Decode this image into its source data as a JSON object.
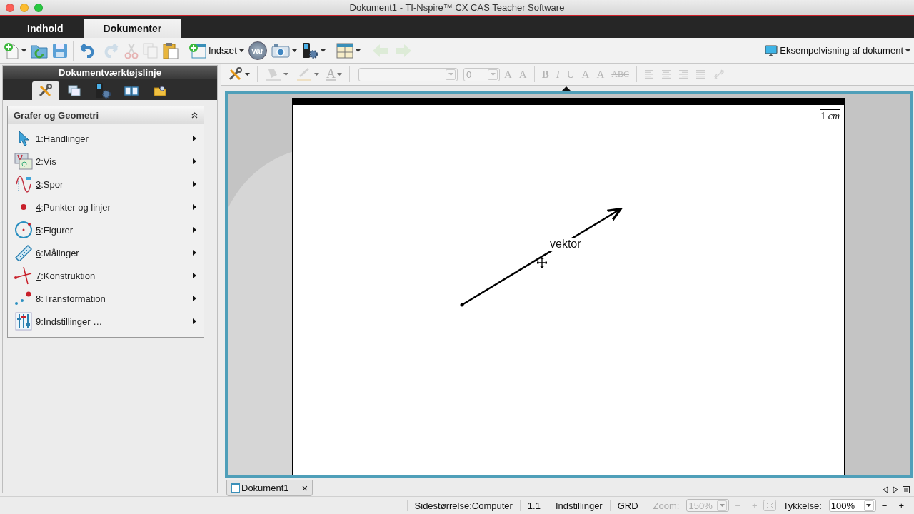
{
  "window": {
    "title": "Dokument1 - TI-Nspire™ CX CAS Teacher Software"
  },
  "tabs": [
    {
      "label": "Indhold",
      "selected": false
    },
    {
      "label": "Dokumenter",
      "selected": true
    }
  ],
  "toolbar": {
    "items": [
      {
        "kind": "new",
        "disabled": false,
        "dropdown": true
      },
      {
        "kind": "open",
        "disabled": false,
        "dropdown": false
      },
      {
        "kind": "save",
        "disabled": false,
        "dropdown": false
      },
      {
        "kind": "sep"
      },
      {
        "kind": "undo",
        "disabled": false,
        "dropdown": false
      },
      {
        "kind": "redo",
        "disabled": true,
        "dropdown": false
      },
      {
        "kind": "cut",
        "disabled": true,
        "dropdown": false
      },
      {
        "kind": "copy",
        "disabled": true,
        "dropdown": false
      },
      {
        "kind": "paste",
        "disabled": false,
        "dropdown": false
      },
      {
        "kind": "sep"
      },
      {
        "kind": "insert",
        "label": "Indsæt",
        "disabled": false,
        "dropdown": true
      },
      {
        "kind": "var",
        "label": "var",
        "disabled": false,
        "dropdown": false
      },
      {
        "kind": "camera",
        "disabled": false,
        "dropdown": true
      },
      {
        "kind": "handheld",
        "disabled": false,
        "dropdown": true
      },
      {
        "kind": "sep"
      },
      {
        "kind": "layout",
        "disabled": false,
        "dropdown": true
      },
      {
        "kind": "sep"
      },
      {
        "kind": "back",
        "disabled": true,
        "dropdown": false
      },
      {
        "kind": "forward",
        "disabled": true,
        "dropdown": false
      }
    ],
    "preview": {
      "label": "Eksempelvisning af dokument",
      "dropdown": true
    }
  },
  "sidebar": {
    "title": "Dokumentværktøjslinje",
    "tool_tabs": [
      {
        "kind": "tools",
        "selected": true
      },
      {
        "kind": "pages",
        "selected": false
      },
      {
        "kind": "handheld",
        "selected": false
      },
      {
        "kind": "book",
        "selected": false
      },
      {
        "kind": "folder",
        "selected": false
      }
    ],
    "menu": {
      "title": "Grafer og Geometri",
      "expanded": true,
      "items": [
        {
          "kind": "pointer",
          "shortcut": "1",
          "label": ":Handlinger"
        },
        {
          "kind": "view",
          "shortcut": "2",
          "label": ":Vis"
        },
        {
          "kind": "trace",
          "shortcut": "3",
          "label": ":Spor"
        },
        {
          "kind": "point",
          "shortcut": "4",
          "label": ":Punkter og linjer"
        },
        {
          "kind": "circle",
          "shortcut": "5",
          "label": ":Figurer"
        },
        {
          "kind": "ruler",
          "shortcut": "6",
          "label": ":Målinger"
        },
        {
          "kind": "construct",
          "shortcut": "7",
          "label": ":Konstruktion"
        },
        {
          "kind": "transform",
          "shortcut": "8",
          "label": ":Transformation"
        },
        {
          "kind": "settings",
          "shortcut": "9",
          "label": ":Indstillinger …"
        }
      ]
    }
  },
  "format_toolbar": {
    "items": [
      {
        "kind": "tools",
        "disabled": false,
        "dropdown": true
      },
      {
        "kind": "sep"
      },
      {
        "kind": "fill",
        "disabled": true,
        "dropdown": true
      },
      {
        "kind": "linecolor",
        "disabled": true,
        "dropdown": true
      },
      {
        "kind": "textcolor",
        "label": "A",
        "disabled": true,
        "dropdown": true
      },
      {
        "kind": "sep"
      },
      {
        "kind": "fontfield",
        "disabled": true
      },
      {
        "kind": "sizefield",
        "value": "0",
        "disabled": true
      },
      {
        "kind": "grow",
        "label": "A",
        "disabled": true
      },
      {
        "kind": "shrink",
        "label": "A",
        "disabled": true
      },
      {
        "kind": "sep"
      },
      {
        "kind": "bold",
        "label": "B",
        "disabled": true
      },
      {
        "kind": "italic",
        "label": "I",
        "disabled": true
      },
      {
        "kind": "underline",
        "label": "U",
        "disabled": true
      },
      {
        "kind": "sup",
        "label": "A",
        "disabled": true
      },
      {
        "kind": "sub",
        "label": "A",
        "disabled": true
      },
      {
        "kind": "strike",
        "label": "ABC",
        "disabled": true
      },
      {
        "kind": "sep"
      },
      {
        "kind": "alignleft",
        "disabled": true
      },
      {
        "kind": "aligncenter",
        "disabled": true
      },
      {
        "kind": "alignright",
        "disabled": true
      },
      {
        "kind": "justify",
        "disabled": true
      },
      {
        "kind": "link",
        "disabled": true
      }
    ]
  },
  "page": {
    "scale_label": "1 *cm*",
    "vector_label": "vektor"
  },
  "doc_tabs": [
    {
      "label": "Dokument1",
      "close": "×",
      "selected": true
    }
  ],
  "status_bar": {
    "page_size": "Sidestørrelse:Computer",
    "page_number": "1.1",
    "settings": "Indstillinger",
    "angle_mode": "GRD",
    "zoom_label": "Zoom:",
    "zoom_value": "150%",
    "zoom_disabled": true,
    "zoom_minus": "−",
    "zoom_plus": "+",
    "thickness_label": "Tykkelse:",
    "thickness_value": "100%",
    "thickness_minus": "−",
    "thickness_plus": "+"
  }
}
